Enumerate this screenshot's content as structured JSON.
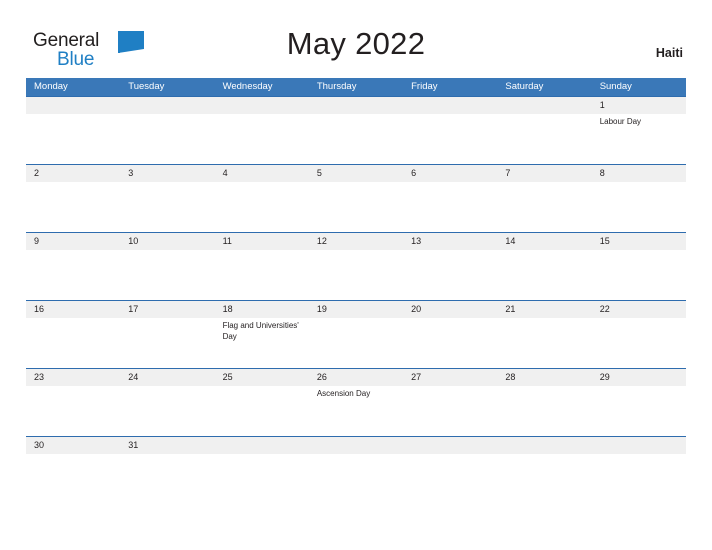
{
  "brand": {
    "name_part1": "General",
    "name_part2": "Blue",
    "flag_icon": "blue-flag-triangle",
    "color_dark": "#221f1f",
    "color_blue": "#1f7fc4"
  },
  "header": {
    "title": "May 2022",
    "country": "Haiti"
  },
  "theme": {
    "header_blue": "#3a78b8",
    "row_divider_blue": "#2e6cae",
    "date_band_gray": "#f0f0f0",
    "text": "#231f20"
  },
  "calendar": {
    "month": "May",
    "year": "2022",
    "day_headers": [
      "Monday",
      "Tuesday",
      "Wednesday",
      "Thursday",
      "Friday",
      "Saturday",
      "Sunday"
    ],
    "weeks": [
      {
        "days": [
          {
            "num": "",
            "event": ""
          },
          {
            "num": "",
            "event": ""
          },
          {
            "num": "",
            "event": ""
          },
          {
            "num": "",
            "event": ""
          },
          {
            "num": "",
            "event": ""
          },
          {
            "num": "",
            "event": ""
          },
          {
            "num": "1",
            "event": "Labour Day"
          }
        ]
      },
      {
        "days": [
          {
            "num": "2",
            "event": ""
          },
          {
            "num": "3",
            "event": ""
          },
          {
            "num": "4",
            "event": ""
          },
          {
            "num": "5",
            "event": ""
          },
          {
            "num": "6",
            "event": ""
          },
          {
            "num": "7",
            "event": ""
          },
          {
            "num": "8",
            "event": ""
          }
        ]
      },
      {
        "days": [
          {
            "num": "9",
            "event": ""
          },
          {
            "num": "10",
            "event": ""
          },
          {
            "num": "11",
            "event": ""
          },
          {
            "num": "12",
            "event": ""
          },
          {
            "num": "13",
            "event": ""
          },
          {
            "num": "14",
            "event": ""
          },
          {
            "num": "15",
            "event": ""
          }
        ]
      },
      {
        "days": [
          {
            "num": "16",
            "event": ""
          },
          {
            "num": "17",
            "event": ""
          },
          {
            "num": "18",
            "event": "Flag and Universities' Day"
          },
          {
            "num": "19",
            "event": ""
          },
          {
            "num": "20",
            "event": ""
          },
          {
            "num": "21",
            "event": ""
          },
          {
            "num": "22",
            "event": ""
          }
        ]
      },
      {
        "days": [
          {
            "num": "23",
            "event": ""
          },
          {
            "num": "24",
            "event": ""
          },
          {
            "num": "25",
            "event": ""
          },
          {
            "num": "26",
            "event": "Ascension Day"
          },
          {
            "num": "27",
            "event": ""
          },
          {
            "num": "28",
            "event": ""
          },
          {
            "num": "29",
            "event": ""
          }
        ]
      },
      {
        "days": [
          {
            "num": "30",
            "event": ""
          },
          {
            "num": "31",
            "event": ""
          },
          {
            "num": "",
            "event": ""
          },
          {
            "num": "",
            "event": ""
          },
          {
            "num": "",
            "event": ""
          },
          {
            "num": "",
            "event": ""
          },
          {
            "num": "",
            "event": ""
          }
        ]
      }
    ]
  }
}
